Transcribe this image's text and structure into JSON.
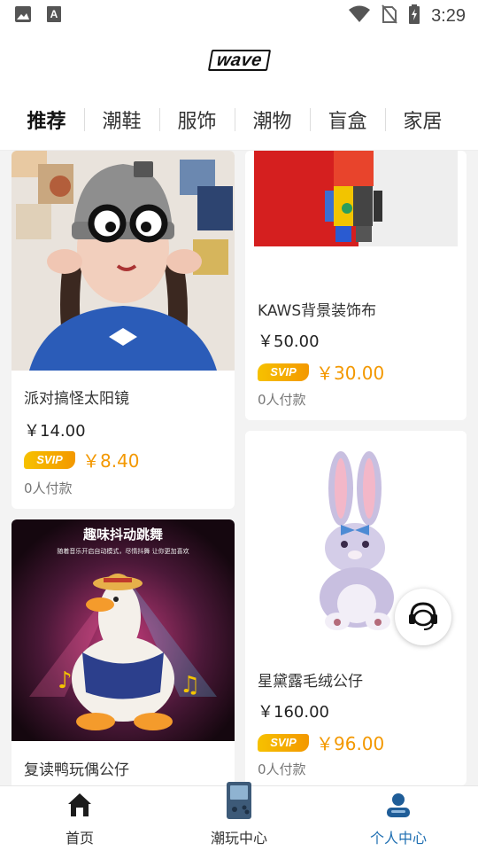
{
  "status_bar": {
    "time": "3:29",
    "icons": [
      "image-icon",
      "font-a-icon",
      "wifi-icon",
      "no-sim-icon",
      "battery-charging-icon"
    ]
  },
  "header": {
    "logo_text": "wave"
  },
  "tabs": [
    {
      "label": "推荐",
      "active": true
    },
    {
      "label": "潮鞋",
      "active": false
    },
    {
      "label": "服饰",
      "active": false
    },
    {
      "label": "潮物",
      "active": false
    },
    {
      "label": "盲盒",
      "active": false
    },
    {
      "label": "家居",
      "active": false
    }
  ],
  "products": [
    {
      "title": "派对搞怪太阳镜",
      "price": "￥14.00",
      "svip_label": "SVIP",
      "svip_price": "￥8.40",
      "sales": "0人付款"
    },
    {
      "title": "KAWS背景装饰布",
      "price": "￥50.00",
      "svip_label": "SVIP",
      "svip_price": "￥30.00",
      "sales": "0人付款"
    },
    {
      "title": "星黛露毛绒公仔",
      "price": "￥160.00",
      "svip_label": "SVIP",
      "svip_price": "￥96.00",
      "sales": "0人付款"
    },
    {
      "title": "复读鸭玩偶公仔",
      "image_text_title": "趣味抖动跳舞",
      "image_text_sub": "随着音乐开启自动模式，尽情抖舞 让你更加喜欢"
    }
  ],
  "bottom_nav": [
    {
      "label": "首页",
      "icon": "home-icon",
      "active": false
    },
    {
      "label": "潮玩中心",
      "icon": "gameboy-icon",
      "active": false
    },
    {
      "label": "个人中心",
      "icon": "user-icon",
      "active": true
    }
  ],
  "colors": {
    "accent_orange": "#f39800",
    "active_nav_blue": "#1f6fb2",
    "feed_bg": "#f3f3f3"
  }
}
